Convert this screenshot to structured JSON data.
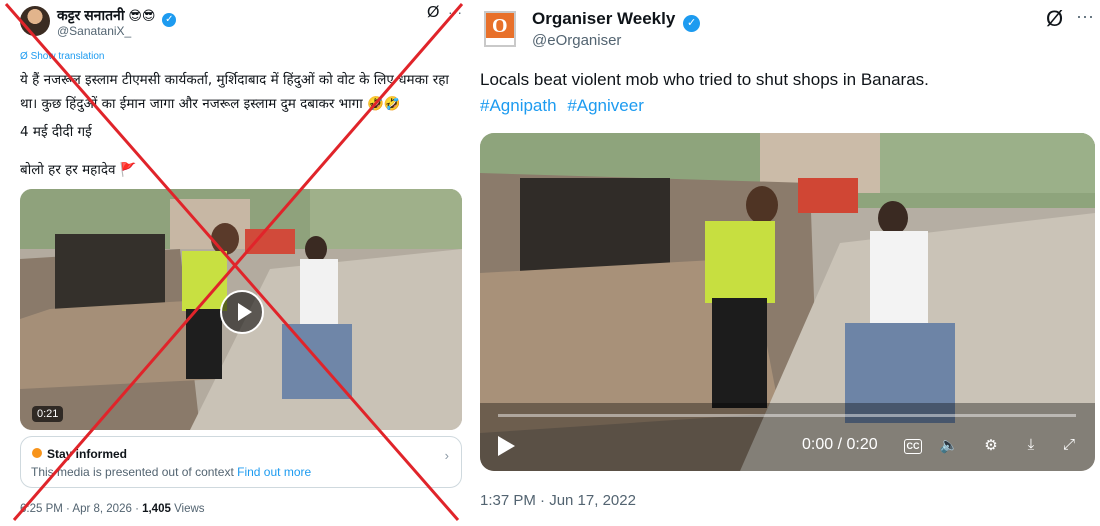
{
  "left_tweet": {
    "author_name": "कट्टर सनातनी",
    "author_emoji": "😎😎",
    "handle": "@SanataniX_",
    "translate_label": "Show translation",
    "text_line1": "ये हैं नजरूल इस्लाम टीएमसी कार्यकर्ता, मुर्शिदाबाद में हिंदुओं को वोट के लिए धमका रहा",
    "text_line2": "था। कुछ हिंदुओं का ईमान जागा और नजरूल इस्लाम दुम दबाकर भागा 🤣🤣",
    "text_p2": "4 मई दीदी गई",
    "text_p3": "बोलो हर हर महादेव",
    "flag_emoji": "🚩",
    "video_duration": "0:21",
    "notice_title": "Stay informed",
    "notice_body": "This media is presented out of context",
    "notice_link": "Find out more",
    "meta_time": "6:25 PM · Apr 8, 2026 · ",
    "views_count": "1,405",
    "views_label": " Views",
    "cross_color": "#e0242a"
  },
  "right_tweet": {
    "author_name": "Organiser Weekly",
    "logo_letter": "O",
    "handle": "@eOrganiser",
    "text": "Locals beat violent mob who tried to shut shops in Banaras.",
    "hashtags": [
      "#Agnipath",
      "#Agniveer"
    ],
    "video_time": "0:00 / 0:20",
    "cc_label": "CC",
    "meta_time": "1:37 PM · Jun 17, 2022",
    "accent": "#1d9bf0"
  },
  "icons": {
    "verified": "✓",
    "grok": "Ø",
    "more": "···",
    "chevron": "›",
    "volume": "🔈",
    "settings": "⚙",
    "minimize": "⤓",
    "fullscreen": "⤢"
  }
}
